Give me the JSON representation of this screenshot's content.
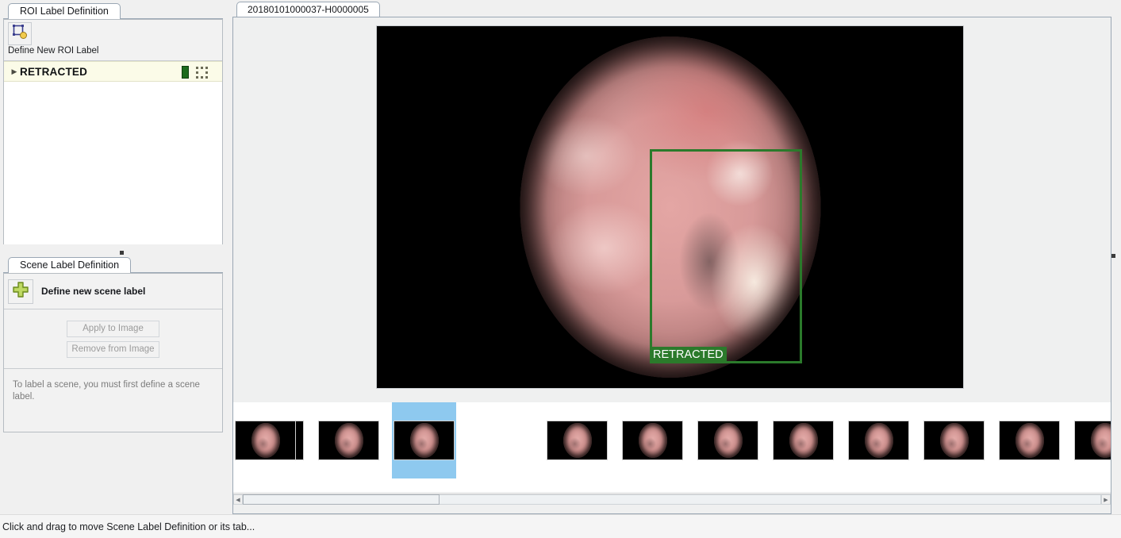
{
  "roi_panel": {
    "tab_label": "ROI Label Definition",
    "define_button_caption": "Define New ROI Label",
    "define_icon": "roi-rectangle-add-icon",
    "labels": [
      {
        "name": "RETRACTED",
        "color": "#1d6b1d",
        "shape_icon": "dashed-rectangle-roi-icon",
        "expanded": false,
        "disclosure_glyph": "▶"
      }
    ]
  },
  "scene_panel": {
    "tab_label": "Scene Label Definition",
    "define_button_caption": "Define new scene label",
    "define_icon": "green-plus-icon",
    "apply_button_label": "Apply to Image",
    "remove_button_label": "Remove from Image",
    "hint_text": "To label a scene, you must first define a scene label."
  },
  "document": {
    "tab_label": "20180101000037-H0000005"
  },
  "viewer": {
    "roi_annotation": {
      "label": "RETRACTED",
      "color": "#2b7a2b"
    }
  },
  "filmstrip": {
    "selected_index": 2,
    "selected_highlight_color": "#8ec9ef",
    "thumbnails": [
      {
        "index": 0
      },
      {
        "index": 1
      },
      {
        "index": 2
      },
      {
        "index": 3
      },
      {
        "index": 4
      },
      {
        "index": 5
      },
      {
        "index": 6
      },
      {
        "index": 7
      },
      {
        "index": 8
      },
      {
        "index": 9
      },
      {
        "index": 10
      },
      {
        "index": 11
      }
    ],
    "scroll_left_arrow": "◀",
    "scroll_right_arrow": "▶"
  },
  "statusbar": {
    "message": "Click and drag to move Scene Label Definition or its tab..."
  }
}
